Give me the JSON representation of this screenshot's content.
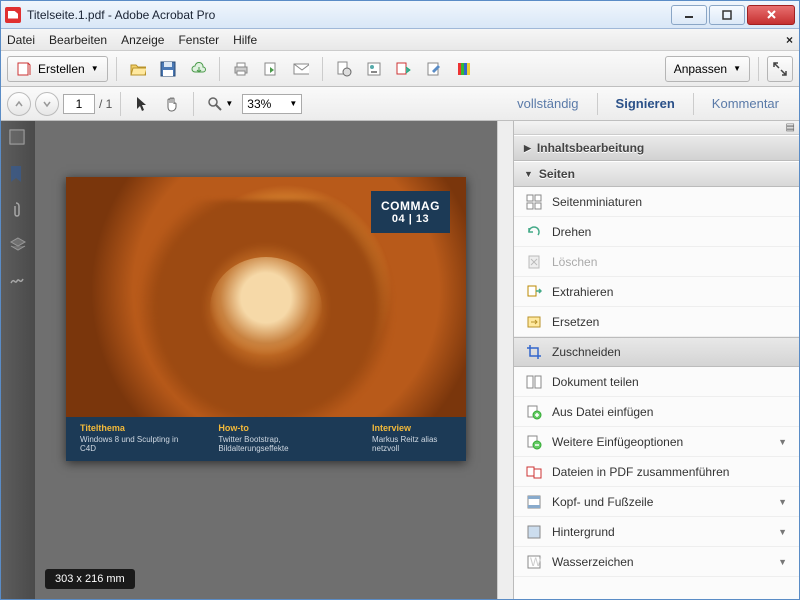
{
  "window": {
    "title": "Titelseite.1.pdf - Adobe Acrobat Pro"
  },
  "menu": {
    "file": "Datei",
    "edit": "Bearbeiten",
    "view": "Anzeige",
    "window": "Fenster",
    "help": "Hilfe"
  },
  "toolbar": {
    "create": "Erstellen",
    "customize": "Anpassen"
  },
  "nav": {
    "page": "1",
    "pages": "/ 1",
    "zoom": "33%"
  },
  "rtabs": {
    "full": "vollständig",
    "sign": "Signieren",
    "comment": "Kommentar"
  },
  "doc": {
    "badge_name": "COMMAG",
    "badge_issue": "04 | 13",
    "col1_h": "Titelthema",
    "col1_t": "Windows 8 und Sculpting in C4D",
    "col2_h": "How-to",
    "col2_t": "Twitter Bootstrap, Bildalterungseffekte",
    "col3_h": "Interview",
    "col3_t": "Markus Reitz alias netzvoll",
    "size": "303 x 216 mm"
  },
  "panel": {
    "inhalt": "Inhaltsbearbeitung",
    "seiten": "Seiten",
    "tools": [
      {
        "label": "Seitenminiaturen",
        "icon": "thumbs"
      },
      {
        "label": "Drehen",
        "icon": "rotate"
      },
      {
        "label": "Löschen",
        "icon": "delete",
        "disabled": true
      },
      {
        "label": "Extrahieren",
        "icon": "extract"
      },
      {
        "label": "Ersetzen",
        "icon": "replace"
      },
      {
        "label": "Zuschneiden",
        "icon": "crop",
        "selected": true
      },
      {
        "label": "Dokument teilen",
        "icon": "split"
      },
      {
        "label": "Aus Datei einfügen",
        "icon": "insert"
      },
      {
        "label": "Weitere Einfügeoptionen",
        "icon": "more",
        "sub": true
      },
      {
        "label": "Dateien in PDF zusammenführen",
        "icon": "merge"
      },
      {
        "label": "Kopf- und Fußzeile",
        "icon": "header",
        "sub": true
      },
      {
        "label": "Hintergrund",
        "icon": "background",
        "sub": true
      },
      {
        "label": "Wasserzeichen",
        "icon": "watermark",
        "sub": true
      }
    ]
  }
}
